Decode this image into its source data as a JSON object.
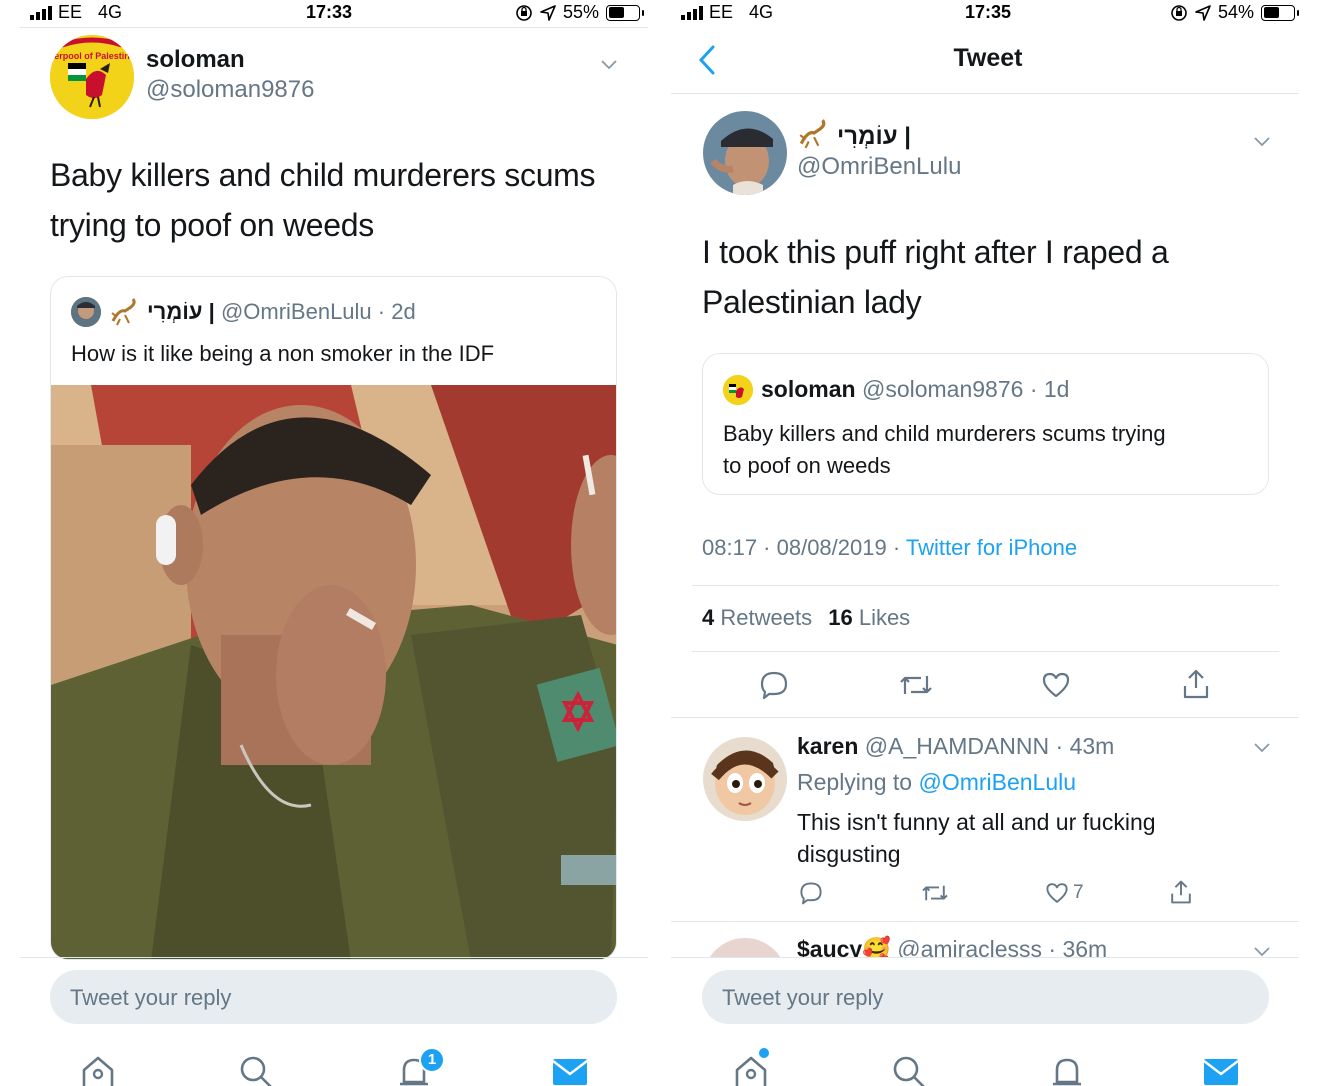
{
  "left": {
    "status": {
      "carrier": "EE",
      "network": "4G",
      "time": "17:33",
      "battery": "55%",
      "battery_level": 0.55
    },
    "tweet": {
      "avatar_label": "verpool of Palestine",
      "display_name": "soloman",
      "handle": "@soloman9876",
      "text_line1": "Baby killers and child murderers scums",
      "text_line2": "trying to poof on weeds"
    },
    "quote": {
      "display_name": "עוֹמְרִי |",
      "handle": "@OmriBenLulu",
      "time": "· 2d",
      "text": "How is it like being a non smoker in the IDF"
    },
    "reply_placeholder": "Tweet your reply",
    "tabbar": {
      "notification_count": "1"
    }
  },
  "right": {
    "status": {
      "carrier": "EE",
      "network": "4G",
      "time": "17:35",
      "battery": "54%",
      "battery_level": 0.54
    },
    "header": {
      "title": "Tweet"
    },
    "tweet": {
      "display_name": "עוֹמְרִי |",
      "handle": "@OmriBenLulu",
      "text_line1": "I took this puff right after I raped a",
      "text_line2": "Palestinian lady",
      "timestamp": "08:17 · 08/08/2019 · ",
      "source": "Twitter for iPhone",
      "retweets_count": "4",
      "retweets_label": "Retweets",
      "likes_count": "16",
      "likes_label": "Likes"
    },
    "quote": {
      "display_name": "soloman",
      "handle": "@soloman9876",
      "time": "· 1d",
      "text_line1": "Baby killers and child murderers scums trying",
      "text_line2": "to poof on weeds"
    },
    "replies": [
      {
        "display_name": "karen",
        "handle": "@A_HAMDANNN",
        "time": "· 43m",
        "replying_prefix": "Replying to ",
        "replying_to": "@OmriBenLulu",
        "text_line1": "This isn't funny at all and ur fucking",
        "text_line2": "disgusting",
        "likes": "7"
      },
      {
        "display_name": "$aucy🥰",
        "handle": "@amiraclesss",
        "time": "· 36m"
      }
    ],
    "reply_placeholder": "Tweet your reply"
  },
  "colors": {
    "link": "#1da1f2",
    "muted": "#657786",
    "divider": "#e1e8ed",
    "reply_bg": "#e6ecf0"
  }
}
